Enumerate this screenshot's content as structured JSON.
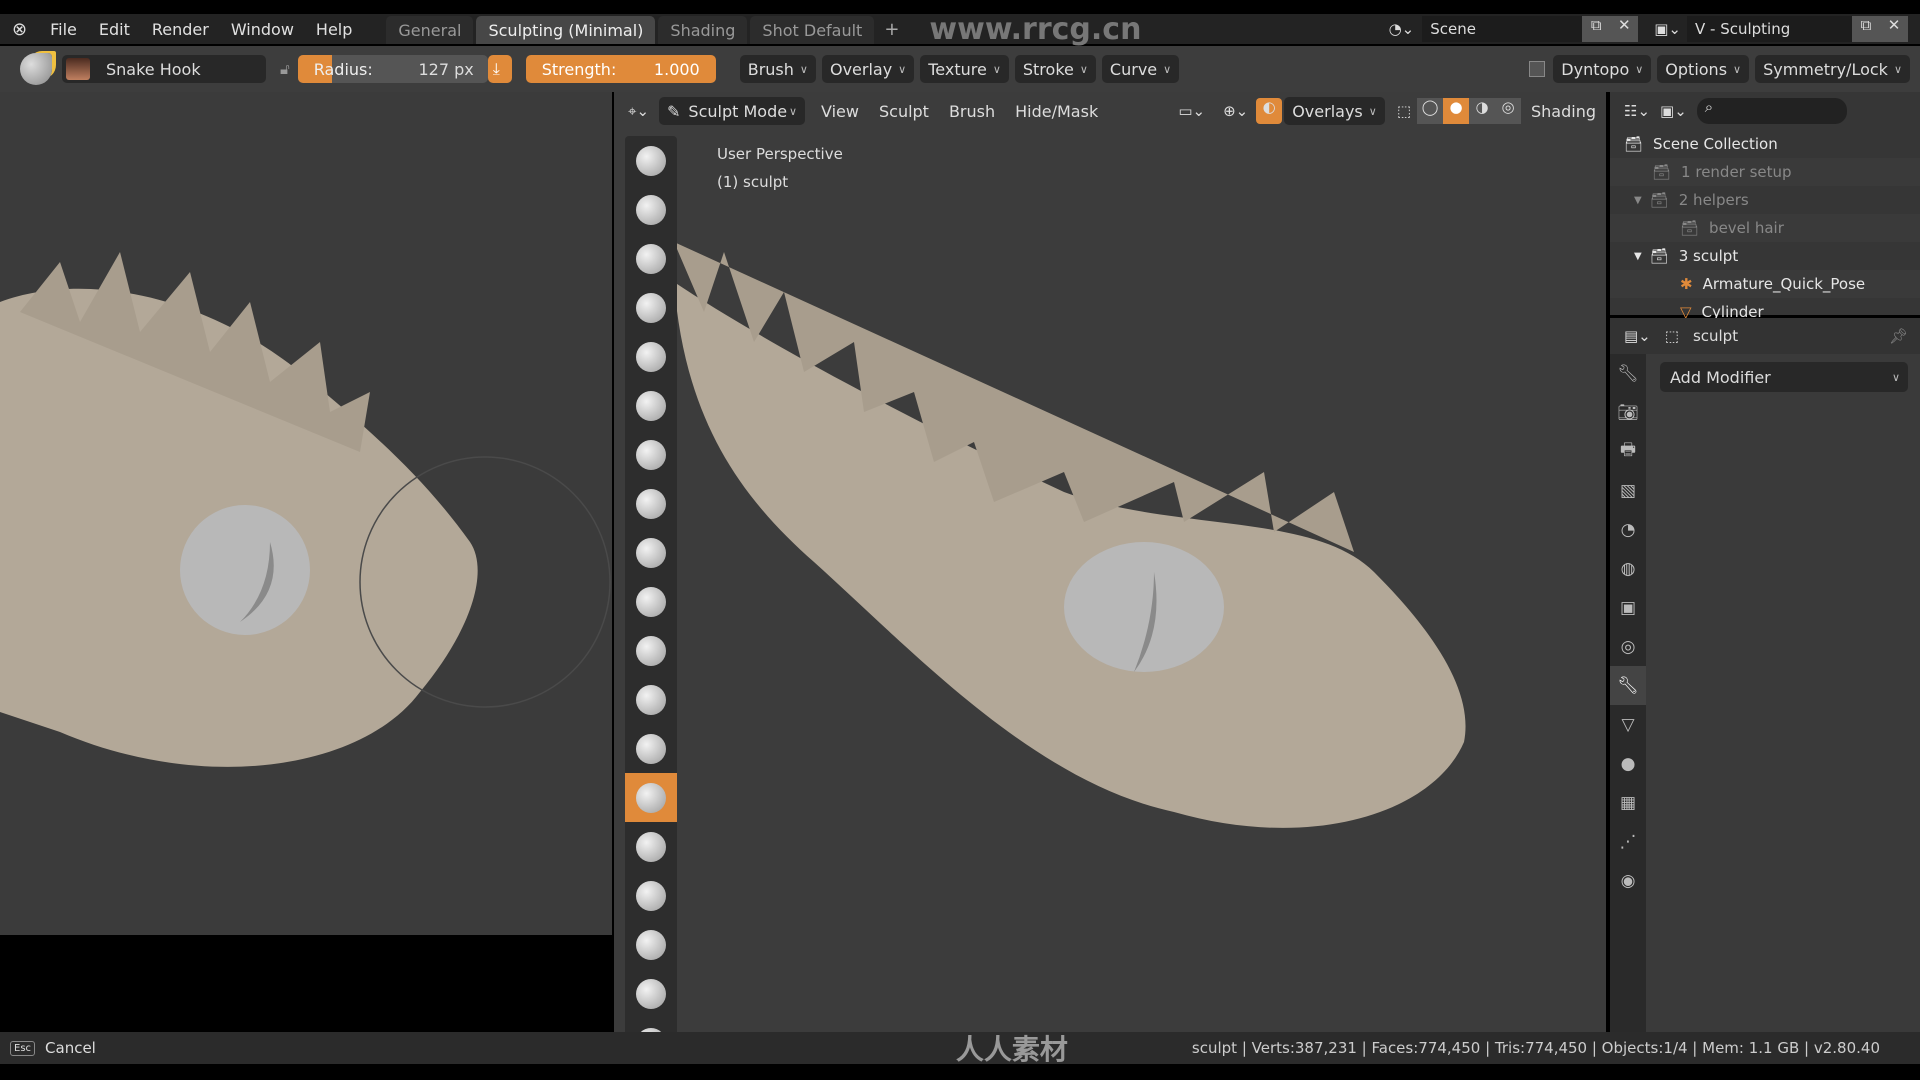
{
  "menubar": {
    "items": [
      "File",
      "Edit",
      "Render",
      "Window",
      "Help"
    ],
    "workspace_tabs": [
      {
        "label": "General",
        "active": false
      },
      {
        "label": "Sculpting (Minimal)",
        "active": true
      },
      {
        "label": "Shading",
        "active": false
      },
      {
        "label": "Shot Default",
        "active": false
      }
    ],
    "add_tab": "+",
    "scene": "Scene",
    "view_layer": "V - Sculpting"
  },
  "watermark": {
    "url": "www.rrcg.cn",
    "logo": "人人素材"
  },
  "tool_header": {
    "brush_name": "Snake Hook",
    "radius_label": "Radius:",
    "radius_value": "127 px",
    "radius_fraction": 0.18,
    "strength_label": "Strength:",
    "strength_value": "1.000",
    "menus": [
      "Brush",
      "Overlay",
      "Texture",
      "Stroke",
      "Curve"
    ],
    "dyntopo": "Dyntopo",
    "dyntopo_checked": false,
    "options": "Options",
    "symmetry": "Symmetry/Lock"
  },
  "viewport": {
    "mode": "Sculpt Mode",
    "menus": [
      "View",
      "Sculpt",
      "Brush",
      "Hide/Mask"
    ],
    "overlays": "Overlays",
    "shading": "Shading",
    "shading_active": "solid",
    "perspective": "User Perspective",
    "object": "(1) sculpt",
    "active_tool_index": 13,
    "tool_count": 19
  },
  "outliner": {
    "items": [
      {
        "label": "Scene Collection",
        "icon": "collection-icon",
        "depth": 0,
        "dim": false
      },
      {
        "label": "1 render setup",
        "icon": "collection-icon",
        "depth": 1,
        "dim": true
      },
      {
        "label": "2 helpers",
        "icon": "collection-icon",
        "depth": 1,
        "dim": true,
        "expanded": true
      },
      {
        "label": "bevel hair",
        "icon": "collection-icon",
        "depth": 2,
        "dim": true
      },
      {
        "label": "3 sculpt",
        "icon": "collection-icon",
        "depth": 1,
        "dim": false,
        "expanded": true
      },
      {
        "label": "Armature_Quick_Pose",
        "icon": "armature-icon",
        "depth": 2,
        "dim": false
      },
      {
        "label": "Cylinder",
        "icon": "mesh-icon",
        "depth": 2,
        "dim": false
      }
    ]
  },
  "properties": {
    "object": "sculpt",
    "add_modifier": "Add Modifier",
    "active_tab": "modifier"
  },
  "status": {
    "cancel_key": "Esc",
    "cancel": "Cancel",
    "stats": "sculpt | Verts:387,231 | Faces:774,450 | Tris:774,450 | Objects:1/4 | Mem: 1.1 GB | v2.80.40"
  },
  "colors": {
    "accent": "#e08a3a",
    "skin": "#b3a898",
    "eye": "#b8b8b8"
  }
}
